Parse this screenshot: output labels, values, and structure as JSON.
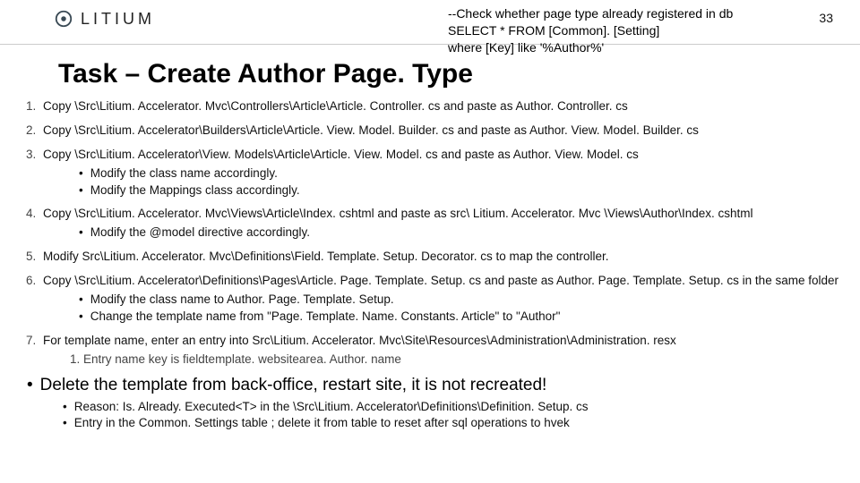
{
  "logo_text": "LITIUM",
  "page_num": "33",
  "topnote": {
    "l1": "--Check whether page type already registered in db",
    "l2": "SELECT *  FROM [Common]. [Setting]",
    "l3": "where [Key] like '%Author%'"
  },
  "title": "Task – Create Author Page. Type",
  "items": [
    {
      "text": "Copy \\Src\\Litium. Accelerator. Mvc\\Controllers\\Article\\Article. Controller. cs and paste as Author. Controller. cs"
    },
    {
      "text": "Copy \\Src\\Litium. Accelerator\\Builders\\Article\\Article. View. Model. Builder. cs and paste as Author. View. Model. Builder. cs"
    },
    {
      "text": "Copy \\Src\\Litium. Accelerator\\View. Models\\Article\\Article. View. Model. cs and paste as Author. View. Model. cs",
      "subs": [
        "Modify the class name accordingly.",
        "Modify the Mappings class accordingly."
      ]
    },
    {
      "text": "Copy \\Src\\Litium. Accelerator. Mvc\\Views\\Article\\Index. cshtml and paste as src\\ Litium. Accelerator. Mvc \\Views\\Author\\Index. cshtml",
      "subs": [
        "Modify the @model directive accordingly."
      ]
    },
    {
      "text": "Modify Src\\Litium. Accelerator. Mvc\\Definitions\\Field. Template. Setup. Decorator. cs to map the controller."
    },
    {
      "text": "Copy \\Src\\Litium. Accelerator\\Definitions\\Pages\\Article. Page. Template. Setup. cs and paste as Author. Page. Template. Setup. cs in the same folder",
      "subs": [
        "Modify the class name to Author. Page. Template. Setup.",
        "Change the template name from \"Page. Template. Name. Constants. Article\" to \"Author\""
      ]
    },
    {
      "text": "For template name, enter an entry into Src\\Litium. Accelerator. Mvc\\Site\\Resources\\Administration\\Administration. resx",
      "inner": [
        "Entry name key is fieldtemplate. websitearea. Author. name"
      ]
    }
  ],
  "final": "Delete the template from back-office, restart site, it is not recreated!",
  "final_subs": [
    "Reason: Is. Already. Executed<T> in the \\Src\\Litium. Accelerator\\Definitions\\Definition. Setup. cs",
    "Entry in the Common. Settings table ; delete it from table to reset after sql operations to hvek"
  ]
}
